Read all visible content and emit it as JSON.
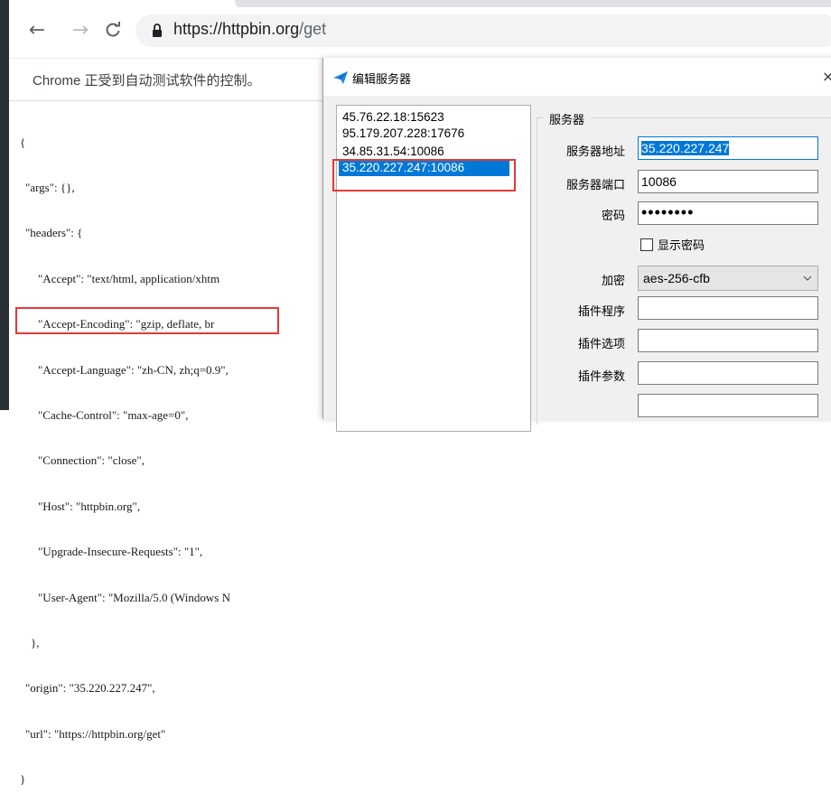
{
  "browser": {
    "url_host": "https://httpbin.org",
    "url_path": "/get",
    "infobar_text": "Chrome 正受到自动测试软件的控制。"
  },
  "json_lines": [
    "{",
    "\"args\": {},",
    "\"headers\": {",
    "\"Accept\": \"text/html, application/xhtm",
    "\"Accept-Encoding\": \"gzip, deflate, br",
    "\"Accept-Language\": \"zh-CN, zh;q=0.9\",",
    "\"Cache-Control\": \"max-age=0\",",
    "\"Connection\": \"close\",",
    "\"Host\": \"httpbin.org\",",
    "\"Upgrade-Insecure-Requests\": \"1\",",
    "\"User-Agent\": \"Mozilla/5.0 (Windows N",
    "},",
    "\"origin\": \"35.220.227.247\",",
    "\"url\": \"https://httpbin.org/get\"",
    "}"
  ],
  "dialog": {
    "title": "编辑服务器",
    "close": "×",
    "servers": [
      "45.76.22.18:15623",
      "95.179.207.228:17676",
      "34.85.31.54:10086",
      "35.220.227.247:10086"
    ],
    "selected_index": 3,
    "group_label": "服务器",
    "fields": {
      "server_address_label": "服务器地址",
      "server_address_value": "35.220.227.247",
      "server_port_label": "服务器端口",
      "server_port_value": "10086",
      "password_label": "密码",
      "password_value": "••••••••",
      "show_password_label": "显示密码",
      "encryption_label": "加密",
      "encryption_value": "aes-256-cfb",
      "plugin_program_label": "插件程序",
      "plugin_program_value": "",
      "plugin_options_label": "插件选项",
      "plugin_options_value": "",
      "plugin_args_label": "插件参数",
      "plugin_args_value": ""
    }
  },
  "colors": {
    "highlight_box": "#e53935",
    "selection": "#0078d7"
  },
  "icons": {
    "back": "arrow-left",
    "forward": "arrow-right",
    "reload": "reload",
    "lock": "lock",
    "dialog_app": "paper-plane"
  }
}
